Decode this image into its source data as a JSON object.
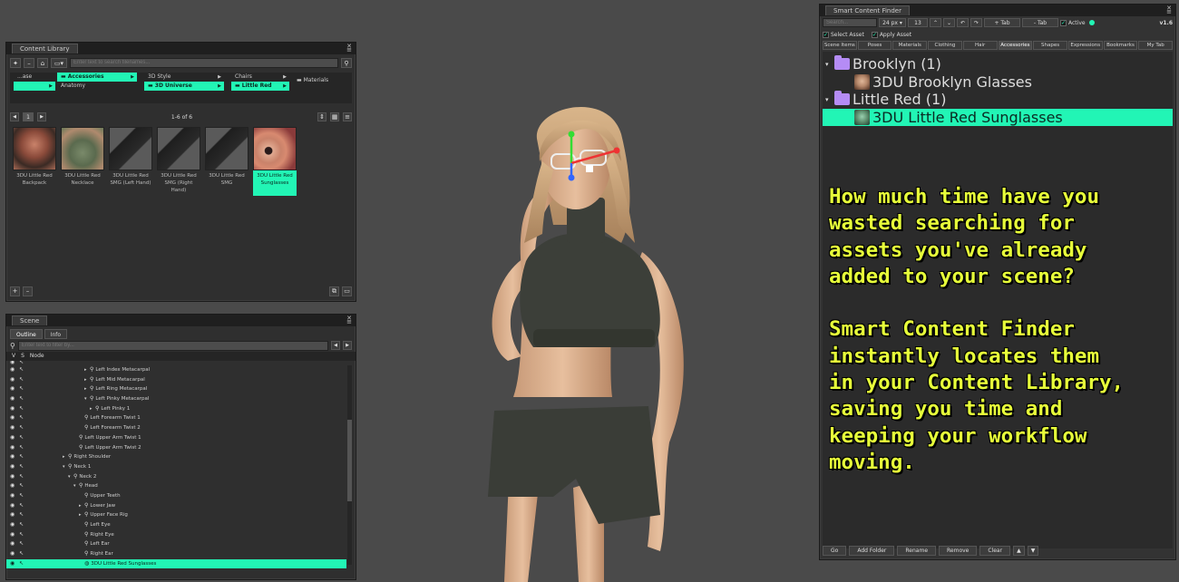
{
  "content_library": {
    "title": "Content Library",
    "search_placeholder": "Enter text to search filenames...",
    "categories": {
      "col1": [
        {
          "label": "...ase"
        },
        {
          "label": "",
          "selected": true
        }
      ],
      "col2": [
        {
          "label": "Accessories",
          "selected": true
        },
        {
          "label": "Anatomy"
        }
      ],
      "col3": [
        {
          "label": "3D Style"
        },
        {
          "label": "3D Universe",
          "selected": true
        }
      ],
      "col4": [
        {
          "label": "Chairs"
        },
        {
          "label": "Little Red",
          "selected": true
        }
      ],
      "col5": [
        {
          "label": "Materials"
        }
      ]
    },
    "page_label": "1",
    "count": "1-6 of 6",
    "items": [
      {
        "caption": "3DU Little Red Backpack",
        "selected": false
      },
      {
        "caption": "3DU Little Red Necklace",
        "selected": false
      },
      {
        "caption": "3DU Little Red SMG (Left Hand)",
        "selected": false
      },
      {
        "caption": "3DU Little Red SMG (Right Hand)",
        "selected": false
      },
      {
        "caption": "3DU Little Red SMG",
        "selected": false
      },
      {
        "caption": "3DU Little Red Sunglasses",
        "selected": true
      }
    ]
  },
  "scene": {
    "title": "Scene",
    "tabs": [
      {
        "label": "Outline",
        "active": true
      },
      {
        "label": "Info",
        "active": false
      }
    ],
    "filter_placeholder": "Enter text to filter by...",
    "columns": {
      "v": "V",
      "s": "S",
      "node": "Node"
    },
    "nodes": [
      {
        "label": "Left Index Metacarpal",
        "indent": 80,
        "arrow": "▸"
      },
      {
        "label": "Left Mid Metacarpal",
        "indent": 80,
        "arrow": "▸"
      },
      {
        "label": "Left Ring Metacarpal",
        "indent": 80,
        "arrow": "▸"
      },
      {
        "label": "Left Pinky Metacarpal",
        "indent": 80,
        "arrow": "▾"
      },
      {
        "label": "Left Pinky 1",
        "indent": 86,
        "arrow": "▸"
      },
      {
        "label": "Left Forearm Twist 1",
        "indent": 74,
        "arrow": ""
      },
      {
        "label": "Left Forearm Twist 2",
        "indent": 74,
        "arrow": ""
      },
      {
        "label": "Left Upper Arm Twist 1",
        "indent": 68,
        "arrow": ""
      },
      {
        "label": "Left Upper Arm Twist 2",
        "indent": 68,
        "arrow": ""
      },
      {
        "label": "Right Shoulder",
        "indent": 56,
        "arrow": "▸"
      },
      {
        "label": "Neck 1",
        "indent": 56,
        "arrow": "▾"
      },
      {
        "label": "Neck 2",
        "indent": 62,
        "arrow": "▾"
      },
      {
        "label": "Head",
        "indent": 68,
        "arrow": "▾"
      },
      {
        "label": "Upper Teeth",
        "indent": 74,
        "arrow": ""
      },
      {
        "label": "Lower Jaw",
        "indent": 74,
        "arrow": "▸"
      },
      {
        "label": "Upper Face Rig",
        "indent": 74,
        "arrow": "▸"
      },
      {
        "label": "Left Eye",
        "indent": 74,
        "arrow": ""
      },
      {
        "label": "Right Eye",
        "indent": 74,
        "arrow": ""
      },
      {
        "label": "Left Ear",
        "indent": 74,
        "arrow": ""
      },
      {
        "label": "Right Ear",
        "indent": 74,
        "arrow": ""
      },
      {
        "label": "3DU Little Red Sunglasses",
        "indent": 74,
        "arrow": "",
        "selected": true
      }
    ]
  },
  "finder": {
    "title": "Smart Content Finder",
    "version": "v1.6",
    "search_placeholder": "Search...",
    "size_label": "24 px",
    "count_value": "13",
    "add_tab": "+ Tab",
    "remove_tab": "- Tab",
    "active_label": "Active",
    "select_asset_label": "Select Asset",
    "apply_asset_label": "Apply Asset",
    "tabs": [
      {
        "label": "Scene Items",
        "active": false
      },
      {
        "label": "Poses",
        "active": false
      },
      {
        "label": "Materials",
        "active": false
      },
      {
        "label": "Clothing",
        "active": false
      },
      {
        "label": "Hair",
        "active": false
      },
      {
        "label": "Accessories",
        "active": true
      },
      {
        "label": "Shapes",
        "active": false
      },
      {
        "label": "Expressions",
        "active": false
      },
      {
        "label": "Bookmarks",
        "active": false
      },
      {
        "label": "My Tab",
        "active": false
      }
    ],
    "results": [
      {
        "type": "folder",
        "label": "Brooklyn (1)",
        "indent": 0
      },
      {
        "type": "asset",
        "label": "3DU Brooklyn Glasses",
        "indent": 22
      },
      {
        "type": "folder",
        "label": "Little Red (1)",
        "indent": 0
      },
      {
        "type": "asset",
        "label": "3DU Little Red Sunglasses",
        "indent": 22,
        "selected": true
      }
    ],
    "promo_text": "How much time have you\nwasted searching for\nassets you've already\nadded to your scene?\n\nSmart Content Finder\ninstantly locates them\nin your Content Library,\nsaving you time and\nkeeping your workflow\nmoving.",
    "bottom_buttons": [
      "Go",
      "Add Folder",
      "Rename",
      "Remove",
      "Clear"
    ]
  },
  "colors": {
    "highlight": "#22f5b5",
    "promo_text": "#e7ff3a",
    "folder": "#b58cf5"
  }
}
